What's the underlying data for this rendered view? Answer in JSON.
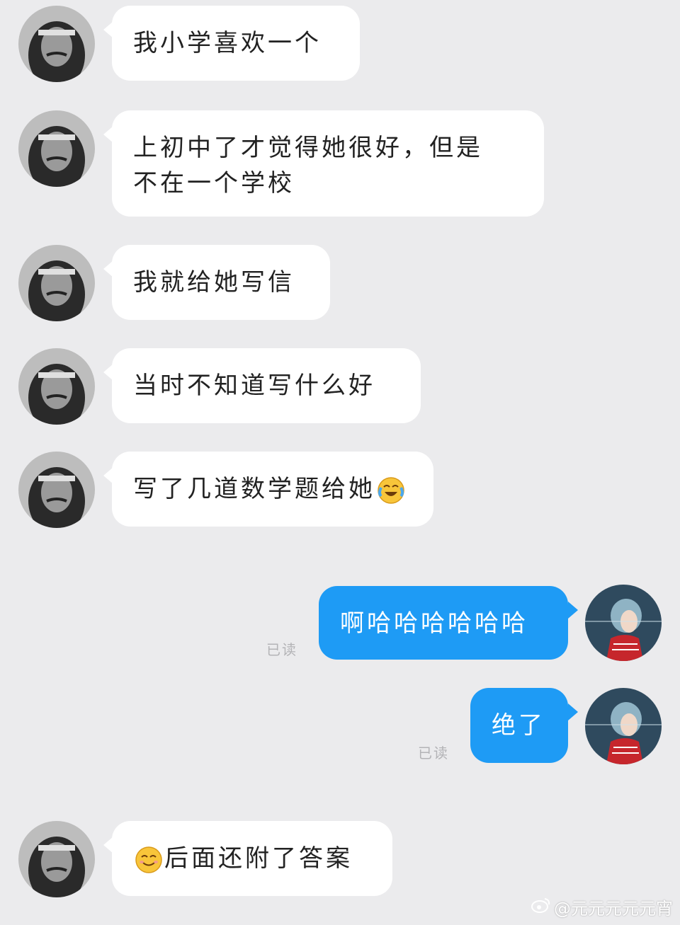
{
  "messages": [
    {
      "text": "我小学喜欢一个"
    },
    {
      "text_line1": "上初中了才觉得她很好，但是",
      "text_line2": "不在一个学校"
    },
    {
      "text": "我就给她写信"
    },
    {
      "text": "当时不知道写什么好"
    },
    {
      "text": "写了几道数学题给她",
      "emoji": "crying-laughing-emoji"
    },
    {
      "text": "啊哈哈哈哈哈哈",
      "status": "已读"
    },
    {
      "text": "绝了",
      "status": "已读"
    },
    {
      "text": "后面还附了答案",
      "emoji": "smiling-emoji"
    }
  ],
  "watermark": {
    "text": "@元元元元元宵"
  },
  "colors": {
    "background": "#ebebed",
    "incoming_bubble": "#ffffff",
    "outgoing_bubble": "#1e9bf5",
    "read_status": "#b3b3b6"
  }
}
